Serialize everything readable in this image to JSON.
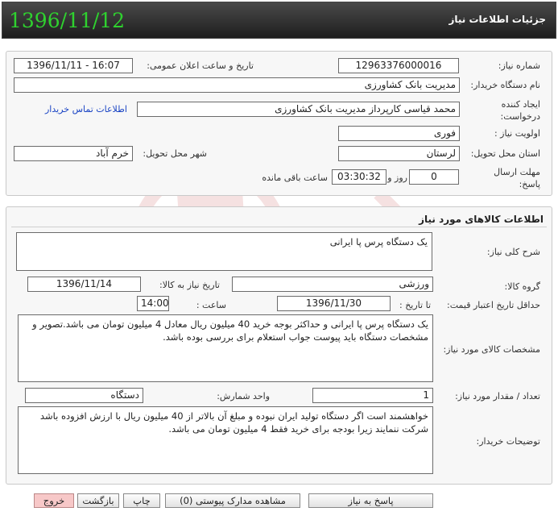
{
  "header": {
    "title": "جزئیات اطلاعات نیاز",
    "date": "1396/11/12"
  },
  "info": {
    "need_number_label": "شماره نیاز:",
    "need_number": "12963376000016",
    "announce_label": "تاریخ و ساعت اعلان عمومی:",
    "announce_value": "1396/11/11 - 16:07",
    "buyer_org_label": "نام دستگاه خریدار:",
    "buyer_org": "مدیریت بانک کشاورزی",
    "creator_label": "ایجاد کننده درخواست:",
    "creator": "محمد قیاسی کارپرداز مدیریت بانک کشاورزی",
    "contact_link": "اطلاعات تماس خریدار",
    "priority_label": "اولویت نیاز :",
    "priority": "فوری",
    "province_label": "استان محل تحویل:",
    "province": "لرستان",
    "city_label": "شهر محل تحویل:",
    "city": "خرم آباد",
    "deadline_label": "مهلت ارسال پاسخ:",
    "deadline_days": "0",
    "days_label": "روز و",
    "deadline_time": "03:30:32",
    "remaining_label": "ساعت باقی مانده"
  },
  "goods": {
    "title": "اطلاعات کالاهای مورد نیاز",
    "general_desc_label": "شرح کلی نیاز:",
    "general_desc": "یک دستگاه پرس پا ایرانی",
    "group_label": "گروه کالا:",
    "group": "ورزشی",
    "need_date_label": "تاریخ نیاز به کالا:",
    "need_date": "1396/11/14",
    "validity_label": "حداقل تاریخ اعتبار قیمت:",
    "until_label": "تا تاریخ :",
    "validity_date": "1396/11/30",
    "time_label": "ساعت :",
    "validity_time": "14:00",
    "specs_label": "مشخصات کالای مورد نیاز:",
    "specs": "یک دستگاه پرس پا ایرانی و حداکثر بوجه خرید 40 میلیون ریال  معادل 4 میلیون تومان می باشد.تصویر و مشخصات دستگاه باید پیوست جواب استعلام برای بررسی بوده باشد.",
    "qty_label": "تعداد / مقدار مورد نیاز:",
    "qty": "1",
    "unit_label": "واحد شمارش:",
    "unit": "دستگاه",
    "buyer_notes_label": "توضیحات خریدار:",
    "buyer_notes": "خواهشمند است اگر دستگاه تولید ایران نبوده و مبلغ آن بالاتر از 40 میلیون ریال  با ارزش افزوده باشد شرکت ننمایند زیرا بودجه برای خرید فقط 4 میلیون تومان می باشد."
  },
  "buttons": {
    "respond": "پاسخ به نیاز",
    "attachments": "مشاهده مدارک پیوستی (0)",
    "print": "چاپ",
    "back": "بازگشت",
    "exit": "خروج"
  }
}
